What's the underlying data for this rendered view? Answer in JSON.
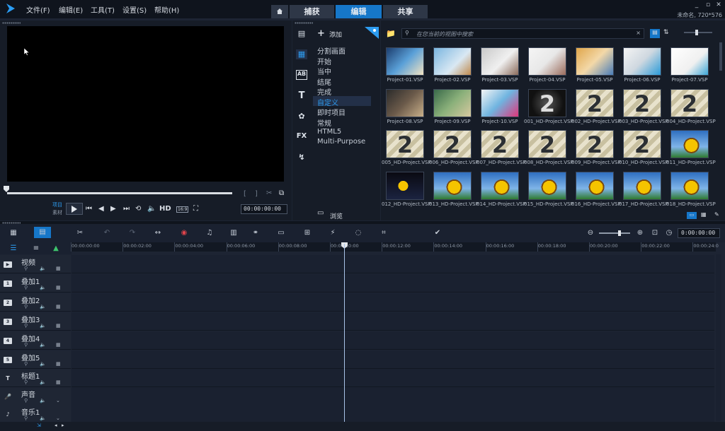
{
  "menu": [
    "文件(F)",
    "编辑(E)",
    "工具(T)",
    "设置(S)",
    "帮助(H)"
  ],
  "modes": {
    "capture": "捕获",
    "edit": "编辑",
    "share": "共享"
  },
  "project_info": "未命名, 720*576",
  "player": {
    "project_label": "项目",
    "clip_label": "素材",
    "hd_label": "HD",
    "aspect_label": "16:9",
    "timecode": "00:00:00:00"
  },
  "library": {
    "add_label": "添加",
    "search_placeholder": "在您当前的视图中搜索",
    "browse_label": "浏览",
    "categories": [
      "分割画面",
      "开始",
      "当中",
      "结尾",
      "完成",
      "自定义",
      "即时项目",
      "常规",
      "HTML5",
      "Multi-Purpose"
    ],
    "selected_category": "自定义",
    "items": [
      "Project-01.VSP",
      "Project-02.VSP",
      "Project-03.VSP",
      "Project-04.VSP",
      "Project-05.VSP",
      "Project-06.VSP",
      "Project-07.VSP",
      "Project-08.VSP",
      "Project-09.VSP",
      "Project-10.VSP",
      "001_HD-Project.VSP",
      "002_HD-Project.VSP",
      "003_HD-Project.VSP",
      "004_HD-Project.VSP",
      "005_HD-Project.VSP",
      "006_HD-Project.VSP",
      "007_HD-Project.VSP",
      "008_HD-Project.VSP",
      "009_HD-Project.VSP",
      "010_HD-Project.VSP",
      "011_HD-Project.VSP",
      "012_HD-Project.VSP",
      "013_HD-Project.VSP",
      "014_HD-Project.VSP",
      "015_HD-Project.VSP",
      "016_HD-Project.VSP",
      "017_HD-Project.VSP",
      "018_HD-Project.VSP"
    ]
  },
  "timeline": {
    "timecode": "0:00:00:00",
    "ruler": [
      "00:00:00:00",
      "00:00:02:00",
      "00:00:04:00",
      "00:00:06:00",
      "00:00:08:00",
      "00:00:10:00",
      "00:00:12:00",
      "00:00:14:00",
      "00:00:16:00",
      "00:00:18:00",
      "00:00:20:00",
      "00:00:22:00",
      "00:00:24:0"
    ],
    "tracks": [
      "视频",
      "叠加1",
      "叠加2",
      "叠加3",
      "叠加4",
      "叠加5",
      "标题1",
      "声音",
      "音乐1"
    ]
  },
  "colors": {
    "accent": "#1677c9",
    "selected_text": "#2d9cf0",
    "background": "#1d2433"
  }
}
